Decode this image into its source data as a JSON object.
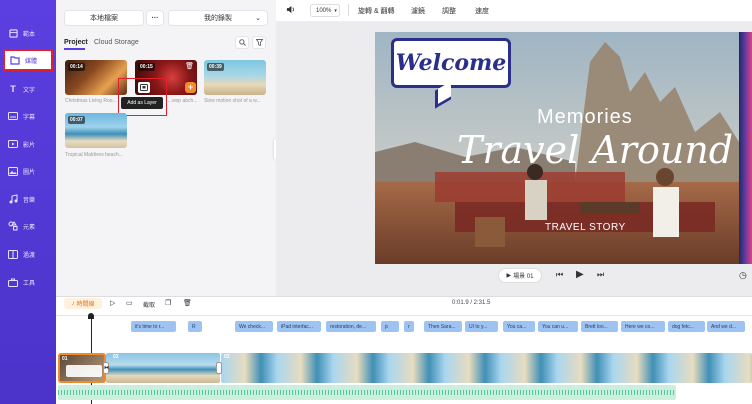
{
  "sidebar": {
    "items": [
      {
        "label": "範本",
        "icon": "template-icon"
      },
      {
        "label": "媒體",
        "icon": "media-folder-icon"
      },
      {
        "label": "文字",
        "icon": "text-icon"
      },
      {
        "label": "字幕",
        "icon": "subtitles-icon"
      },
      {
        "label": "影片",
        "icon": "video-icon"
      },
      {
        "label": "圖片",
        "icon": "image-icon"
      },
      {
        "label": "音樂",
        "icon": "music-icon"
      },
      {
        "label": "元素",
        "icon": "elements-icon"
      },
      {
        "label": "過渡",
        "icon": "transitions-icon"
      },
      {
        "label": "工具",
        "icon": "tools-icon"
      }
    ]
  },
  "panel": {
    "local_files_button": "本地檔案",
    "more_button": "···",
    "my_recordings_button": "我的錄製",
    "tabs": [
      "Project",
      "Cloud Storage"
    ],
    "media": [
      {
        "duration": "00:14",
        "caption": "Christmas Living Roo..."
      },
      {
        "duration": "00:15",
        "caption": "...wxp abch..."
      },
      {
        "duration": "00:39",
        "caption": "Slow motion shot of a w..."
      },
      {
        "duration": "00:07",
        "caption": "Tropical Maldives beach..."
      }
    ],
    "tooltip": "Add as Layer"
  },
  "toolbar": {
    "zoom": "100%",
    "rotate_flip": "旋轉 & 翻轉",
    "filters": "濾鏡",
    "adjust": "調整",
    "speed": "速度"
  },
  "video": {
    "welcome": "Welcome",
    "memories": "Memories",
    "travel_around": "Travel Around",
    "travel_story": "TRAVEL STORY"
  },
  "player": {
    "scene_label": "場景 01"
  },
  "timeline": {
    "keyframe_button": "時間線",
    "split_label": "截取",
    "time": "0:01.9 / 2:31.5",
    "subtitle_chips": [
      "it's time to r...",
      "R",
      "We check...",
      "iPad interfac...",
      "restoration, de...",
      "p",
      "r",
      "Then Sara...",
      "UI to y...",
      "You ca...",
      "You can u...",
      "Brett loo...",
      "Here we co...",
      "dog fetc...",
      "And we d..."
    ],
    "clip_labels": [
      "01",
      "02",
      "03"
    ]
  },
  "colors": {
    "accent": "#5b3fe0",
    "highlight_red": "#e0202a",
    "subtitle_chip": "#9ec3f2",
    "audio_wave": "#8fd9b6"
  }
}
